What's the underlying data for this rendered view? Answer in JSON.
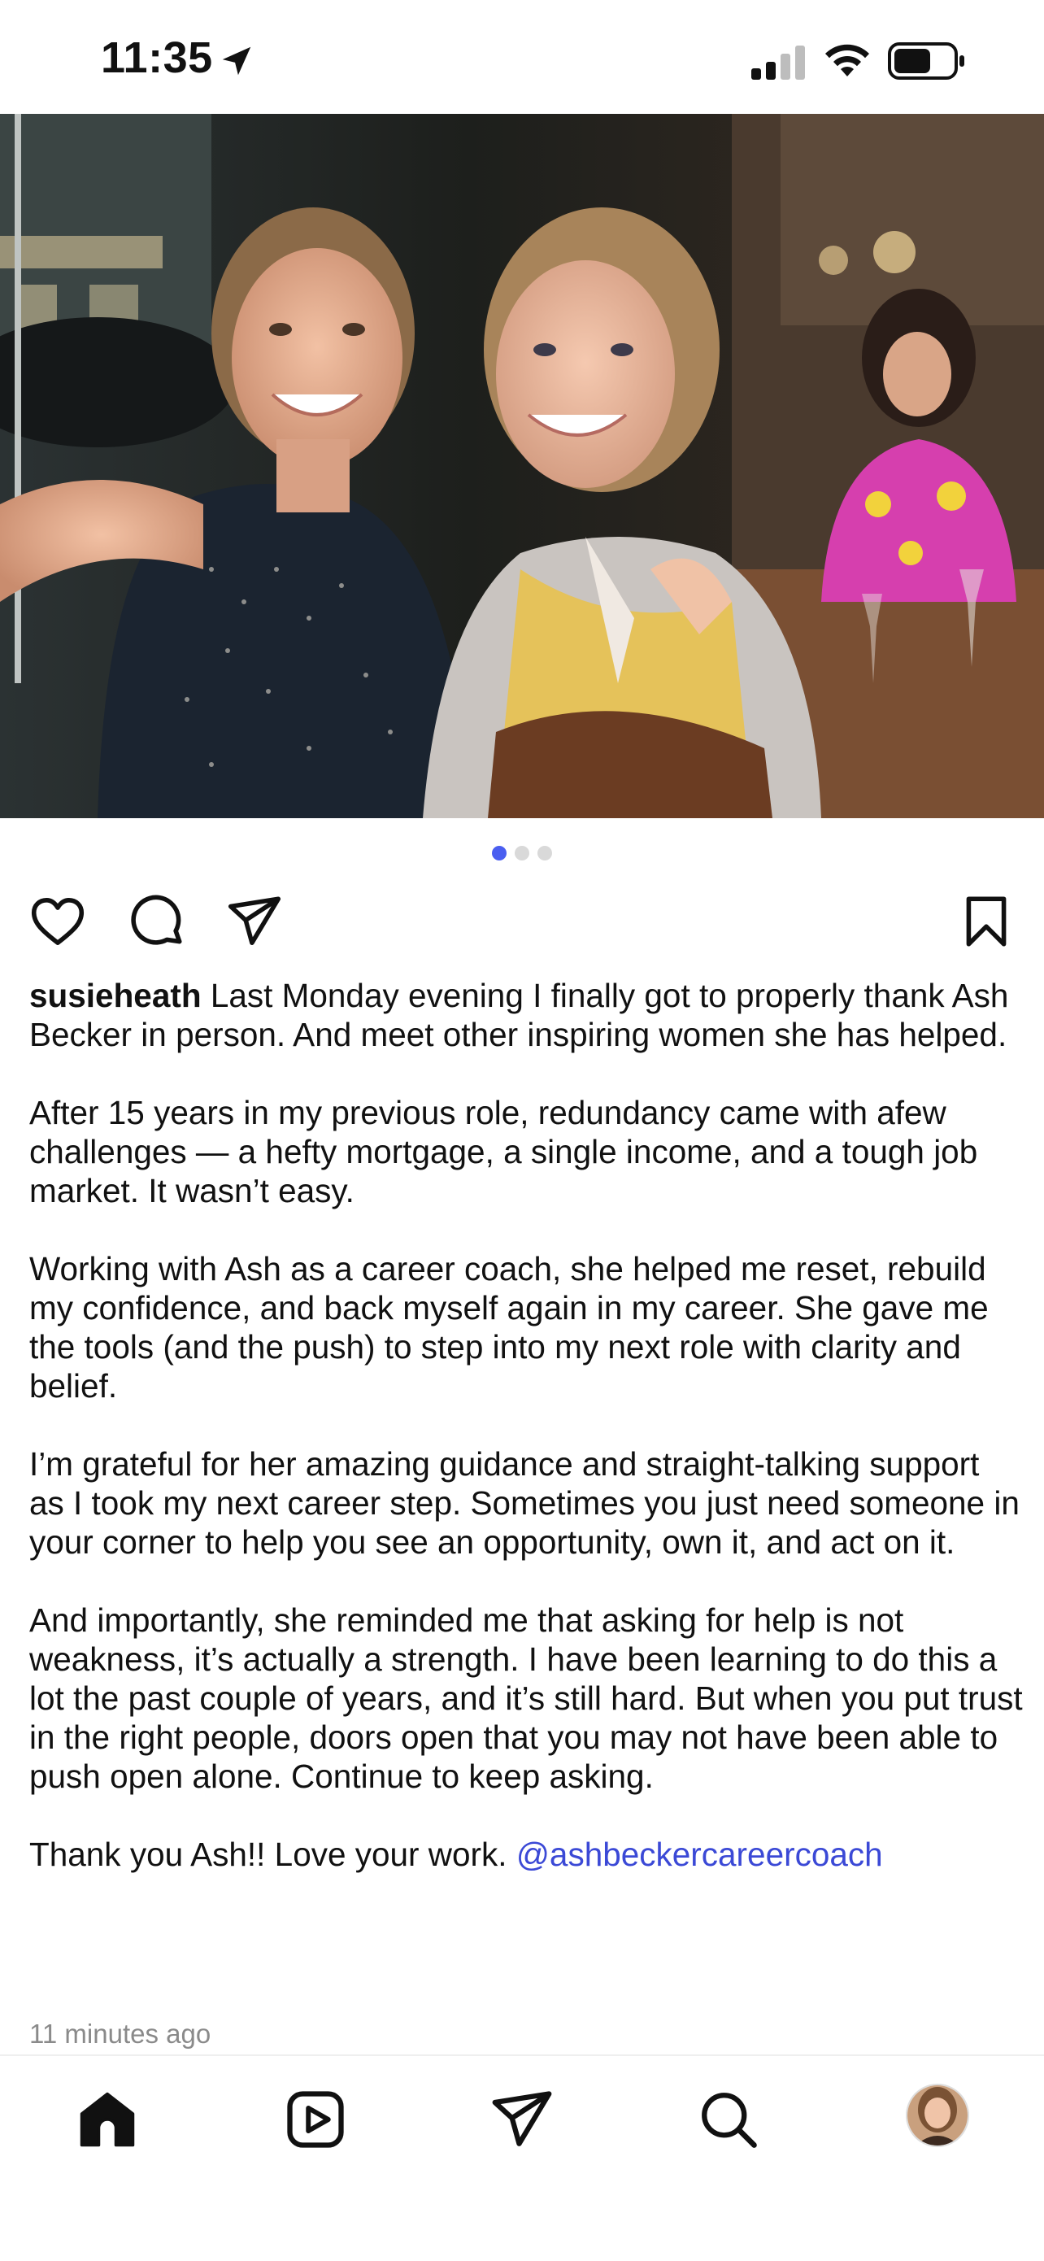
{
  "status_bar": {
    "time": "11:35",
    "icons": [
      "location-arrow-icon",
      "cellular-signal-icon",
      "wifi-icon",
      "battery-icon"
    ]
  },
  "post": {
    "image_alt": "Selfie of two smiling women at an evening restaurant",
    "carousel": {
      "count": 3,
      "active_index": 0
    },
    "actions": [
      "heart-icon",
      "comment-icon",
      "share-icon",
      "bookmark-icon"
    ],
    "username": "susieheath",
    "caption_first": "Last Monday evening I finally got to properly thank Ash Becker in person.  And meet other inspiring women she has helped.",
    "paragraphs": [
      "After 15 years in my previous role, redundancy came with afew challenges — a hefty mortgage, a single income, and a tough job market. It wasn’t easy.",
      "Working with Ash as a career coach, she helped me reset, rebuild my confidence, and back myself again in my career. She gave me the tools (and the push) to step into my next role with clarity and belief.",
      "I’m grateful for her amazing guidance and straight-talking support as I took my next career step.  Sometimes you just need someone in your corner to help you see an opportunity, own it, and act on it.",
      "And importantly, she reminded me that asking for help is not weakness, it’s actually a strength.  I have been learning to do this a lot the past couple of years, and it’s still hard. But when you put trust in the right people, doors open that you may not have been able to push open alone. Continue to keep asking."
    ],
    "closing": "Thank you Ash!! Love your work.",
    "mention": "@ashbeckercareercoach",
    "timestamp": "11 minutes ago"
  },
  "bottom_nav": [
    "home-icon",
    "reels-icon",
    "direct-message-icon",
    "search-icon",
    "profile-avatar"
  ],
  "colors": {
    "accent": "#4a5ef0",
    "mention": "#3b49d6",
    "muted": "#8a8a8a"
  }
}
